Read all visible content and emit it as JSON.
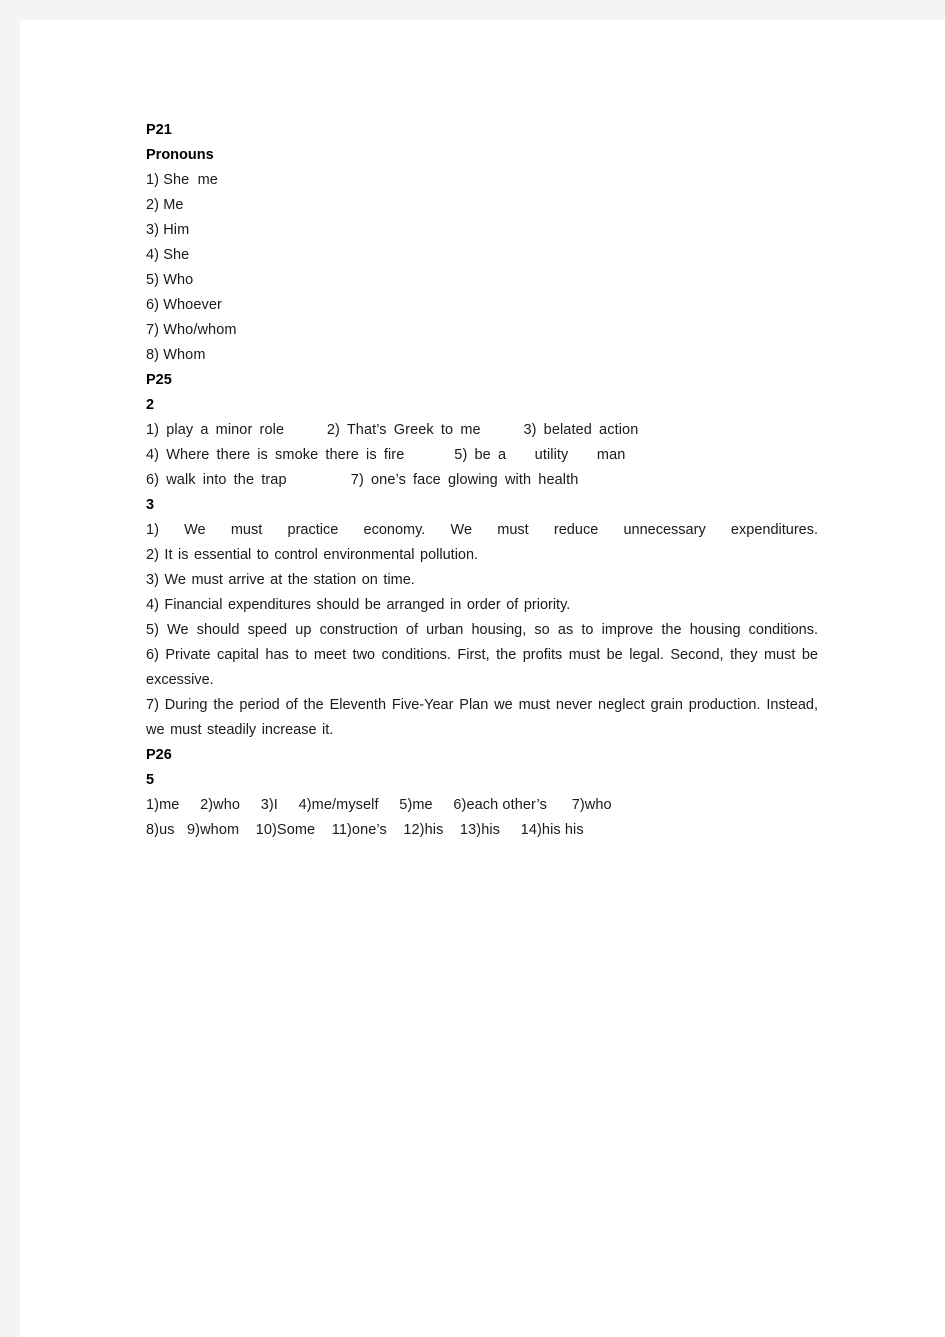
{
  "document": {
    "type": "worksheet-answer-key",
    "sections": [
      {
        "page_label": "P21",
        "title": "Pronouns",
        "subsection": null,
        "items": [
          "1) She  me",
          "2) Me",
          "3) Him",
          "4) She",
          "5) Who",
          "6) Whoever",
          "7) Who/whom",
          "8) Whom"
        ]
      },
      {
        "page_label": "P25",
        "subsection_a": "2",
        "exercise2_lines": [
          "1) play a minor role      2) That’s Greek to me      3) belated action",
          "4) Where there is smoke there is fire       5) be a    utility    man",
          "6) walk into the trap         7) one’s face glowing with health"
        ],
        "subsection_b": "3",
        "exercise3_lines": [
          "1) We must practice economy. We must reduce unnecessary expenditures.",
          "2) It is essential to control environmental pollution.",
          "3) We must arrive at the station on time.",
          "4) Financial expenditures should be arranged in order of priority.",
          "5) We should speed up construction of urban housing, so as to improve the housing conditions.",
          "6) Private capital has to meet two conditions. First, the profits must be legal. Second, they must be excessive.",
          "7) During the period of the Eleventh Five-Year Plan we must never neglect grain production. Instead, we must steadily increase it."
        ]
      },
      {
        "page_label": "P26",
        "subsection": "5",
        "items_lines": [
          "1)me     2)who     3)I     4)me/myself     5)me     6)each other’s      7)who",
          "8)us   9)whom    10)Some    11)one’s    12)his    13)his     14)his his"
        ]
      }
    ]
  }
}
